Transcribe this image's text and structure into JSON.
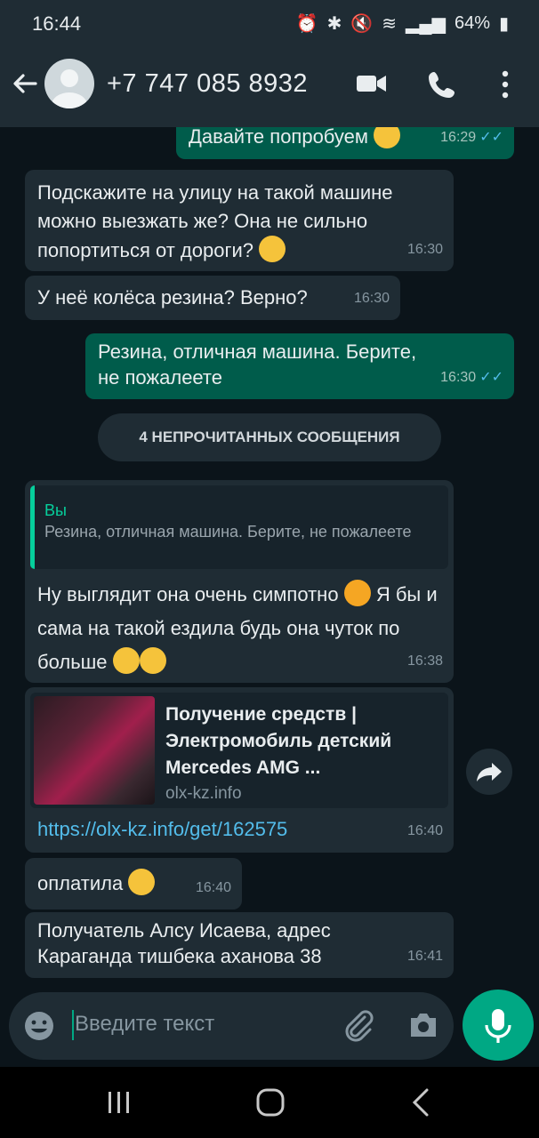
{
  "status": {
    "time": "16:44",
    "battery": "64%"
  },
  "header": {
    "contact": "+7 747 085 8932"
  },
  "messages": {
    "m0": {
      "text": "Давайте попробуем",
      "time": "16:29"
    },
    "m1": {
      "text": "Подскажите на улицу на такой машине можно выезжать же? Она не сильно попортиться от дороги?",
      "time": "16:30"
    },
    "m2": {
      "text": "У неё колёса резина? Верно?",
      "time": "16:30"
    },
    "m3": {
      "text": "Резина, отличная машина. Берите, не пожалеете",
      "time": "16:30"
    },
    "unread": "4 НЕПРОЧИТАННЫХ СООБЩЕНИЯ",
    "m4": {
      "quote_name": "Вы",
      "quote_text": "Резина, отличная машина. Берите, не пожалеете",
      "text_a": "Ну выглядит она очень симпотно",
      "text_b": "Я бы и сама на такой ездила будь она чуток по больше",
      "time": "16:38"
    },
    "m5": {
      "preview_title": "Получение средств | Электромобиль детский Mercedes AMG ...",
      "preview_domain": "olx-kz.info",
      "link": "https://olx-kz.info/get/162575",
      "time": "16:40"
    },
    "m6": {
      "text": "оплатила",
      "time": "16:40"
    },
    "m7": {
      "text": "Получатель Алсу Исаева, адрес Караганда тишбека аханова 38",
      "time": "16:41"
    }
  },
  "input": {
    "placeholder": "Введите текст"
  },
  "icons": {
    "back": "arrow-left-icon",
    "video": "video-call-icon",
    "call": "phone-icon",
    "menu": "more-vert-icon",
    "emoji": "emoji-icon",
    "attach": "paperclip-icon",
    "camera": "camera-icon",
    "mic": "mic-icon",
    "forward": "forward-icon"
  },
  "colors": {
    "accent": "#00a884",
    "outgoing": "#005c4b",
    "incoming": "#1f2c34",
    "read_ticks": "#53bdeb"
  }
}
